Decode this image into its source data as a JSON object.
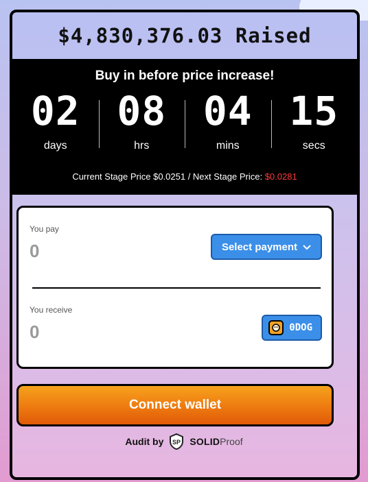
{
  "raised": {
    "text": "$4,830,376.03 Raised"
  },
  "timer": {
    "headline": "Buy in before price increase!",
    "units": [
      {
        "value": "02",
        "label": "days"
      },
      {
        "value": "08",
        "label": "hrs"
      },
      {
        "value": "04",
        "label": "mins"
      },
      {
        "value": "15",
        "label": "secs"
      }
    ],
    "stage": {
      "current_prefix": "Current Stage Price $0.0251 / Next Stage Price: ",
      "next_value": "$0.0281"
    }
  },
  "swap": {
    "pay_caption": "You pay",
    "pay_amount": "0",
    "select_label": "Select payment",
    "receive_caption": "You receive",
    "receive_amount": "0",
    "token_label": "0DOG"
  },
  "connect_label": "Connect wallet",
  "audit": {
    "prefix": "Audit by",
    "brand_strong": "SOLID",
    "brand_light": "Proof",
    "icon": "shield-icon"
  },
  "colors": {
    "accent_blue": "#3b8fe8",
    "connect_orange": "#ee7a10",
    "next_price_red": "#ff3b3b"
  }
}
